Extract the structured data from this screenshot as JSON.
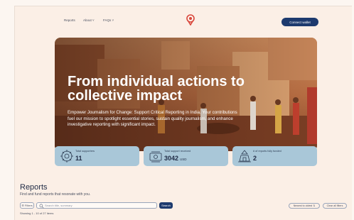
{
  "nav": {
    "links": [
      "Reports",
      "About",
      "FAQs"
    ],
    "connect_label": "Connect wallet"
  },
  "hero": {
    "title_line1": "From individual actions to",
    "title_line2": "collective impact",
    "subtitle_line1": "Empower Journalism for Change: Support Critical Reporting in India. Your contributions",
    "subtitle_line2": "fuel our mission to spotlight essential stories, sustain quality journalism, and enhance",
    "subtitle_line3": "investigative reporting with significant impact."
  },
  "stats": [
    {
      "label": "Total supporters",
      "value": "11",
      "unit": "",
      "icon": "supporters-icon"
    },
    {
      "label": "Total support received",
      "value": "3042",
      "unit": "USD",
      "icon": "money-icon"
    },
    {
      "label": "# of reports fully funded",
      "value": "2",
      "unit": "",
      "icon": "temple-icon"
    }
  ],
  "reports": {
    "title": "Reports",
    "subtitle": "Find and fund reports that resonate with you.",
    "filters_label": "Filters",
    "search_placeholder": "Search title, summary",
    "search_button": "Search",
    "sort_label": "Newest to oldest",
    "clear_label": "Clear all filters",
    "showing": "Showing 1 - 10 of 27 items"
  },
  "colors": {
    "accent": "#1d3a6e",
    "stat_card": "#a9c7d8",
    "background": "#fbefe6",
    "logo": "#d9463b"
  }
}
